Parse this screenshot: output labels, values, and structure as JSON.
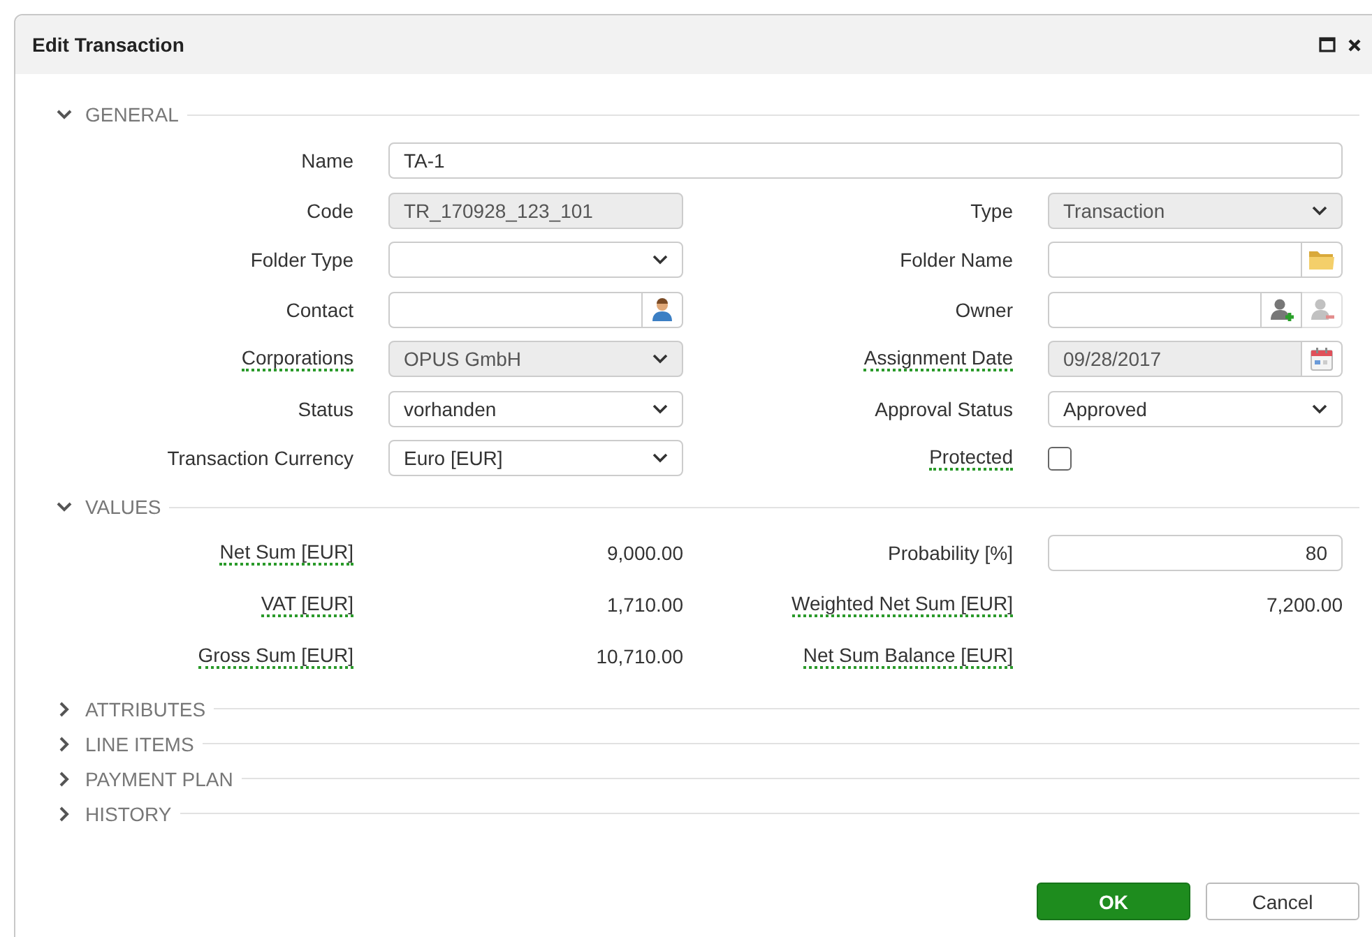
{
  "window": {
    "title": "Edit Transaction"
  },
  "sections": [
    {
      "title": "GENERAL",
      "expanded": true,
      "rows": [
        [
          {
            "label": "Name",
            "tooltip": false,
            "kind": "text",
            "value": "TA-1",
            "disabled": false
          }
        ],
        [
          {
            "label": "Code",
            "tooltip": false,
            "kind": "text",
            "value": "TR_170928_123_101",
            "disabled": true
          },
          {
            "label": "Type",
            "tooltip": false,
            "kind": "select",
            "value": "Transaction",
            "disabled": true
          }
        ],
        [
          {
            "label": "Folder Type",
            "tooltip": false,
            "kind": "select",
            "disabled": false
          },
          {
            "label": "Folder Name",
            "tooltip": false,
            "kind": "lookup",
            "disabled": false,
            "buttons": [
              {
                "kind": "folder",
                "disabled": false
              }
            ]
          }
        ],
        [
          {
            "label": "Contact",
            "tooltip": false,
            "kind": "lookup",
            "disabled": false,
            "buttons": [
              {
                "kind": "person",
                "disabled": false
              }
            ]
          },
          {
            "label": "Owner",
            "tooltip": false,
            "kind": "lookup",
            "disabled": false,
            "buttons": [
              {
                "kind": "person-add",
                "disabled": false
              },
              {
                "kind": "person-remove",
                "disabled": true
              }
            ]
          }
        ],
        [
          {
            "label": "Corporations",
            "tooltip": true,
            "kind": "select",
            "value": "OPUS GmbH",
            "disabled": true
          },
          {
            "label": "Assignment Date",
            "tooltip": true,
            "kind": "lookup",
            "value": "09/28/2017",
            "disabled": true,
            "buttons": [
              {
                "kind": "calendar",
                "disabled": false
              }
            ]
          }
        ],
        [
          {
            "label": "Status",
            "tooltip": false,
            "kind": "select",
            "value": "vorhanden",
            "disabled": false
          },
          {
            "label": "Approval Status",
            "tooltip": false,
            "kind": "select",
            "value": "Approved",
            "disabled": false
          }
        ],
        [
          {
            "label": "Transaction Currency",
            "tooltip": false,
            "kind": "select",
            "value": "Euro [EUR]",
            "disabled": false
          },
          {
            "label": "Protected",
            "tooltip": true,
            "kind": "checkbox",
            "checked": false,
            "disabled": false
          }
        ]
      ]
    },
    {
      "title": "VALUES",
      "expanded": true,
      "rows": [
        [
          {
            "label": "Net Sum [EUR]",
            "tooltip": true,
            "kind": "readout",
            "value": "9,000.00"
          },
          {
            "label": "Probability [%]",
            "tooltip": false,
            "kind": "number",
            "value": "80",
            "disabled": false
          }
        ],
        [
          {
            "label": "VAT [EUR]",
            "tooltip": true,
            "kind": "readout",
            "value": "1,710.00"
          },
          {
            "label": "Weighted Net Sum [EUR]",
            "tooltip": true,
            "kind": "readout",
            "value": "7,200.00"
          }
        ],
        [
          {
            "label": "Gross Sum [EUR]",
            "tooltip": true,
            "kind": "readout",
            "value": "10,710.00"
          },
          {
            "label": "Net Sum Balance [EUR]",
            "tooltip": true,
            "kind": "readout"
          }
        ]
      ]
    },
    {
      "title": "ATTRIBUTES",
      "expanded": false
    },
    {
      "title": "LINE ITEMS",
      "expanded": false
    },
    {
      "title": "PAYMENT PLAN",
      "expanded": false
    },
    {
      "title": "HISTORY",
      "expanded": false
    }
  ],
  "buttons": [
    {
      "label": "OK",
      "kind": "primary"
    },
    {
      "label": "Cancel",
      "kind": "secondary"
    }
  ]
}
